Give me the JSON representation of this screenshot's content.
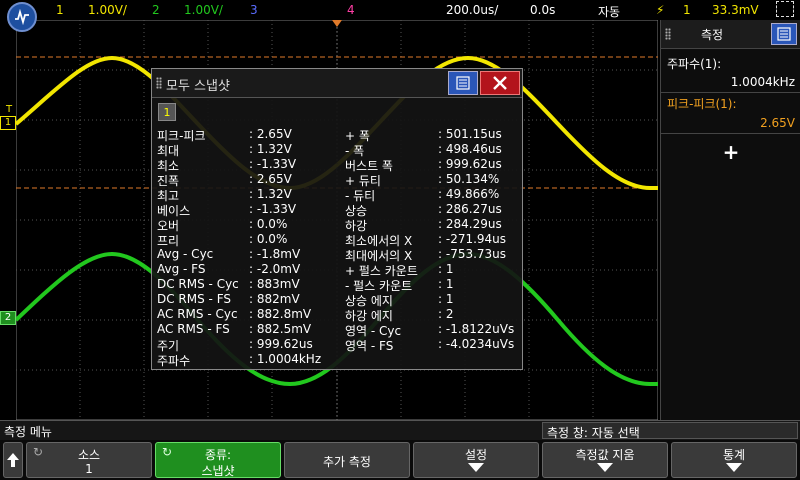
{
  "topbar": {
    "ch1_num": "1",
    "ch1_scale": "1.00V/",
    "ch2_num": "2",
    "ch2_scale": "1.00V/",
    "ch3_num": "3",
    "ch4_num": "4",
    "timebase": "200.0us/",
    "delay": "0.0s",
    "trigger_mode": "자동",
    "trigger_src": "1",
    "trigger_level": "33.3mV"
  },
  "colors": {
    "ch1": "#f2e600",
    "ch2": "#22c81e",
    "ch3": "#5a6cff",
    "ch4": "#ff3ea5",
    "accent": "#2a56b8"
  },
  "channel_markers": {
    "ch1_label": "1",
    "ch2_label": "2",
    "trig_label": "T"
  },
  "dialog": {
    "title": "모두 스냅샷",
    "channel": "1",
    "left": [
      {
        "name": "피크-피크",
        "value": ": 2.65V"
      },
      {
        "name": "최대",
        "value": ": 1.32V"
      },
      {
        "name": "최소",
        "value": ": -1.33V"
      },
      {
        "name": "진폭",
        "value": ": 2.65V"
      },
      {
        "name": "최고",
        "value": ": 1.32V"
      },
      {
        "name": "베이스",
        "value": ": -1.33V"
      },
      {
        "name": "오버",
        "value": ": 0.0%"
      },
      {
        "name": "프리",
        "value": ": 0.0%"
      },
      {
        "name": "Avg - Cyc",
        "value": ": -1.8mV"
      },
      {
        "name": "Avg - FS",
        "value": ": -2.0mV"
      },
      {
        "name": "DC RMS - Cyc",
        "value": ": 883mV"
      },
      {
        "name": "DC RMS - FS",
        "value": ": 882mV"
      },
      {
        "name": "AC RMS - Cyc",
        "value": ": 882.8mV"
      },
      {
        "name": "AC RMS - FS",
        "value": ": 882.5mV"
      },
      {
        "name": "주기",
        "value": ": 999.62us"
      },
      {
        "name": "주파수",
        "value": ": 1.0004kHz"
      }
    ],
    "right": [
      {
        "name": "+ 폭",
        "value": ": 501.15us"
      },
      {
        "name": "- 폭",
        "value": ": 498.46us"
      },
      {
        "name": "버스트 폭",
        "value": ": 999.62us"
      },
      {
        "name": "+ 듀티",
        "value": ": 50.134%"
      },
      {
        "name": "- 듀티",
        "value": ": 49.866%"
      },
      {
        "name": "상승",
        "value": ": 286.27us"
      },
      {
        "name": "하강",
        "value": ": 284.29us"
      },
      {
        "name": "최소에서의 X",
        "value": ": -271.94us"
      },
      {
        "name": "최대에서의 X",
        "value": ": -753.73us"
      },
      {
        "name": "+ 펄스 카운트",
        "value": ": 1"
      },
      {
        "name": "- 펄스 카운트",
        "value": ": 1"
      },
      {
        "name": "상승 에지",
        "value": ": 1"
      },
      {
        "name": "하강 에지",
        "value": ": 2"
      },
      {
        "name": "영역 - Cyc",
        "value": ": -1.8122uVs"
      },
      {
        "name": "영역 - FS",
        "value": ": -4.0234uVs"
      }
    ]
  },
  "rpanel": {
    "title": "측정",
    "m1_label": "주파수(1):",
    "m1_value": "1.0004kHz",
    "m2_label": "피크-피크(1):",
    "m2_value": "2.65V",
    "add": "+"
  },
  "menubar": {
    "left": "측정 메뉴",
    "right": "측정 창: 자동 선택"
  },
  "softkeys": [
    {
      "l1": "소스",
      "l2": "1"
    },
    {
      "l1": "종류:",
      "l2": "스냅샷"
    },
    {
      "l1": "추가 측정",
      "l2": ""
    },
    {
      "l1": "설정",
      "l2": ""
    },
    {
      "l1": "측정값 지움",
      "l2": ""
    },
    {
      "l1": "통계",
      "l2": ""
    }
  ]
}
